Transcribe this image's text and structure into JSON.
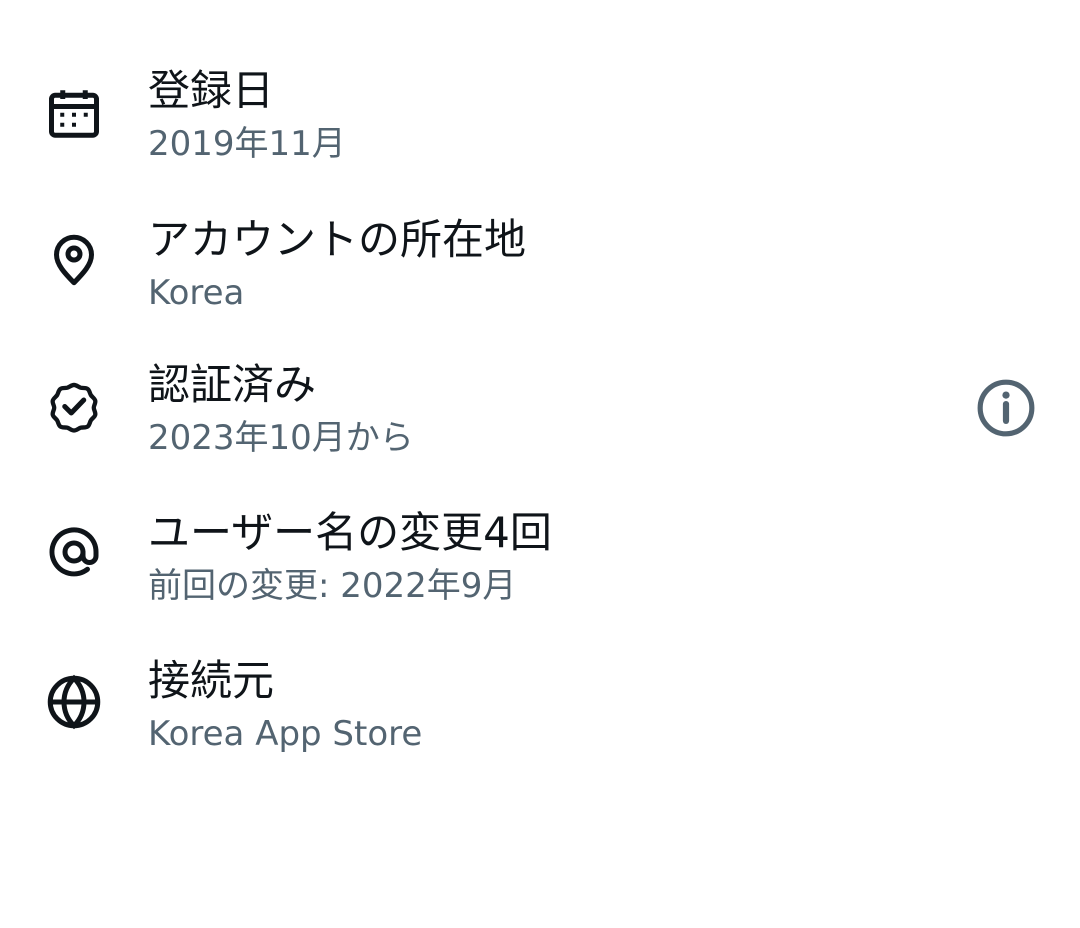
{
  "about": {
    "items": [
      {
        "icon": "calendar-icon",
        "title": "登録日",
        "subtitle": "2019年11月"
      },
      {
        "icon": "location-pin-icon",
        "title": "アカウントの所在地",
        "subtitle": "Korea"
      },
      {
        "icon": "verified-badge-icon",
        "title": "認証済み",
        "subtitle": "2023年10月から",
        "action_icon": "info-icon"
      },
      {
        "icon": "at-sign-icon",
        "title": "ユーザー名の変更4回",
        "subtitle": "前回の変更: 2022年9月"
      },
      {
        "icon": "globe-icon",
        "title": "接続元",
        "subtitle": "Korea App Store"
      }
    ]
  },
  "colors": {
    "title": "#0f1419",
    "subtitle": "#536471",
    "icon": "#0f1419",
    "info_icon": "#536471",
    "background": "#ffffff"
  }
}
